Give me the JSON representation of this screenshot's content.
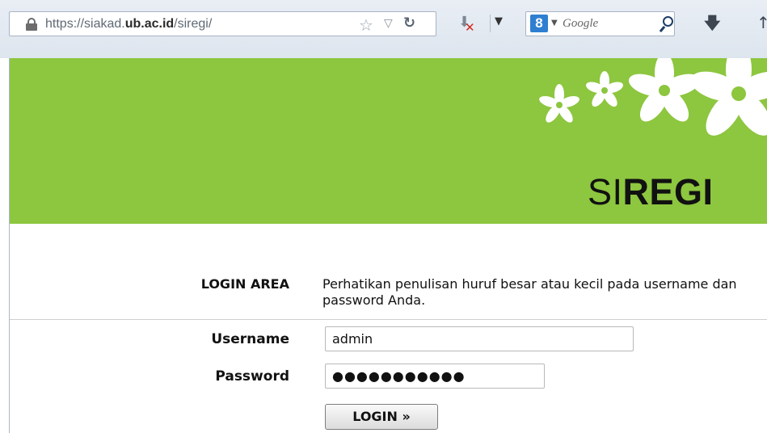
{
  "browser": {
    "url_prefix": "https://siakad.",
    "url_domain": "ub.ac.id",
    "url_path": "/siregi/",
    "search_engine": "Google",
    "search_logo": "8",
    "icons": [
      "lock-icon",
      "bookmark-star-icon",
      "history-dropdown-icon",
      "reload-icon",
      "noscript-icon",
      "menu-dropdown-icon",
      "google-plus-icon",
      "search-icon",
      "download-icon"
    ]
  },
  "site": {
    "title_thin": "SI",
    "title_bold": "REGI",
    "banner_color": "#8dc63f"
  },
  "login": {
    "section_title": "LOGIN AREA",
    "note": "Perhatikan penulisan huruf besar atau kecil pada username dan password Anda.",
    "username_label": "Username",
    "username_value": "admin",
    "password_label": "Password",
    "password_masked": "●●●●●●●●●●●",
    "button_label": "LOGIN »"
  }
}
